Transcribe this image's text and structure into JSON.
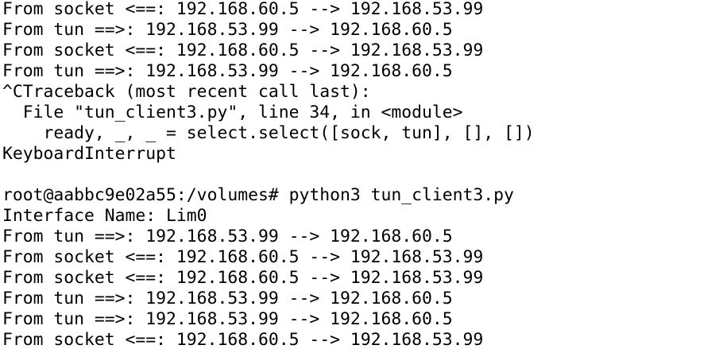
{
  "terminal": {
    "lines": [
      "From socket <==: 192.168.60.5 --> 192.168.53.99",
      "From tun ==>: 192.168.53.99 --> 192.168.60.5",
      "From socket <==: 192.168.60.5 --> 192.168.53.99",
      "From tun ==>: 192.168.53.99 --> 192.168.60.5",
      "^CTraceback (most recent call last):",
      "  File \"tun_client3.py\", line 34, in <module>",
      "    ready, _, _ = select.select([sock, tun], [], [])",
      "KeyboardInterrupt",
      "",
      "root@aabbc9e02a55:/volumes# python3 tun_client3.py",
      "Interface Name: Lim0",
      "From tun ==>: 192.168.53.99 --> 192.168.60.5",
      "From socket <==: 192.168.60.5 --> 192.168.53.99",
      "From socket <==: 192.168.60.5 --> 192.168.53.99",
      "From tun ==>: 192.168.53.99 --> 192.168.60.5",
      "From tun ==>: 192.168.53.99 --> 192.168.60.5",
      "From socket <==: 192.168.60.5 --> 192.168.53.99"
    ]
  }
}
